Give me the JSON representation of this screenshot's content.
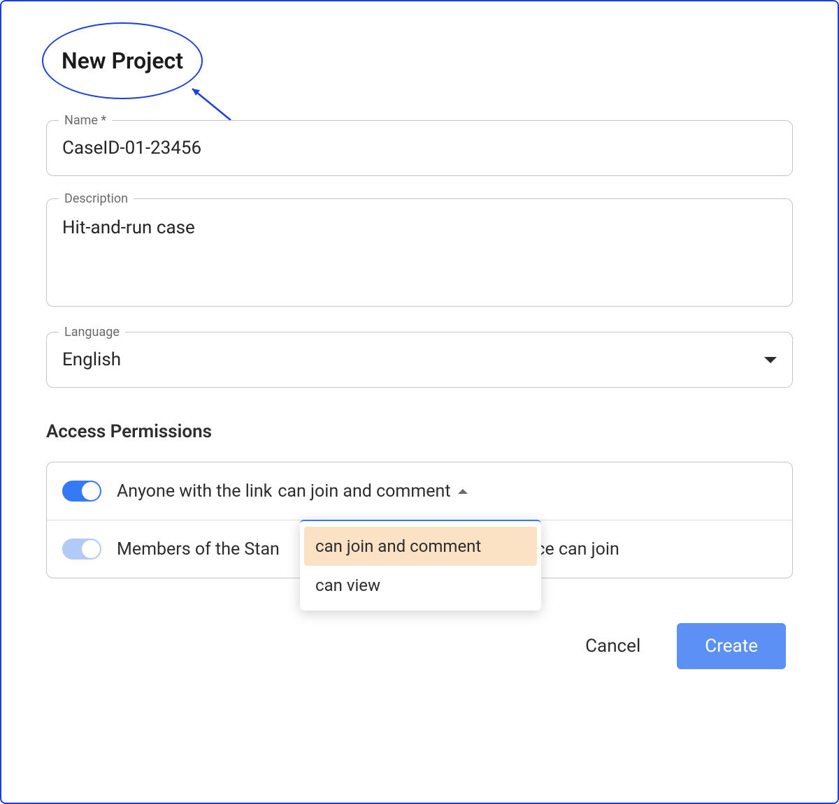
{
  "header": {
    "title": "New Project"
  },
  "fields": {
    "name": {
      "label": "Name *",
      "value": "CaseID-01-23456"
    },
    "description": {
      "label": "Description",
      "value": "Hit-and-run case"
    },
    "language": {
      "label": "Language",
      "value": "English"
    }
  },
  "permissions": {
    "section_title": "Access Permissions",
    "link_access": {
      "prefix": "Anyone with the link",
      "selected": "can join and comment",
      "options": [
        "can join and comment",
        "can view"
      ]
    },
    "member_access": {
      "prefix": "Members of the Stan",
      "suffix": "space can join"
    }
  },
  "buttons": {
    "cancel": "Cancel",
    "create": "Create"
  }
}
